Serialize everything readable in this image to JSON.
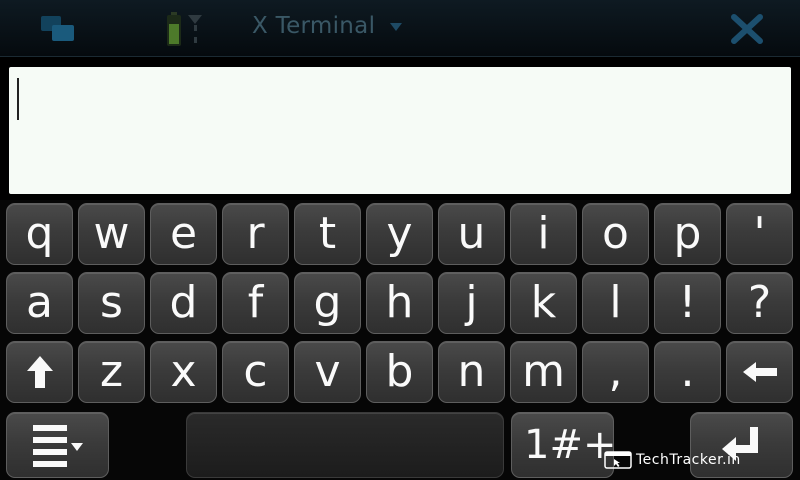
{
  "status_bar": {
    "title": "X Terminal"
  },
  "keyboard": {
    "rows": [
      [
        "q",
        "w",
        "e",
        "r",
        "t",
        "y",
        "u",
        "i",
        "o",
        "p",
        "'"
      ],
      [
        "a",
        "s",
        "d",
        "f",
        "g",
        "h",
        "j",
        "k",
        "l",
        "!",
        "?"
      ],
      [
        "z",
        "x",
        "c",
        "v",
        "b",
        "n",
        "m",
        ",",
        "."
      ]
    ],
    "symbols_key_label": "1#+"
  },
  "watermark": {
    "text": "TechTracker.in"
  },
  "colors": {
    "status_title": "#3a5866",
    "entry_background": "#f6fbf6",
    "key_top": "#4a4a4a",
    "key_bottom": "#2f2f2f",
    "key_text": "#fafafa"
  },
  "icons": {
    "task_switcher": "task-switcher-icon",
    "battery": "battery-icon",
    "menu_arrow": "chevron-down-icon",
    "close": "close-icon",
    "shift": "shift-arrow-icon",
    "backspace": "backspace-arrow-icon",
    "keyboard_menu": "keyboard-menu-icon",
    "enter": "enter-icon"
  }
}
